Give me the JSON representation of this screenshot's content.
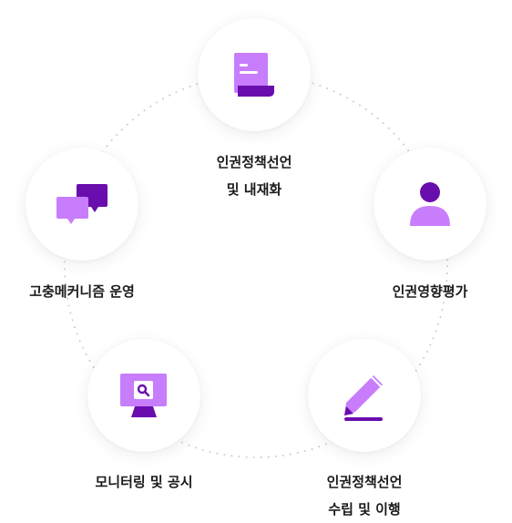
{
  "nodes": [
    {
      "id": "policy-declaration",
      "icon": "document-scroll-icon",
      "lines": [
        "인권정책선언",
        "및 내재화"
      ]
    },
    {
      "id": "impact-assessment",
      "icon": "person-icon",
      "lines": [
        "인권영향평가"
      ]
    },
    {
      "id": "declaration-implementation",
      "icon": "pencil-icon",
      "lines": [
        "인권정책선언",
        "수립 및 이행"
      ]
    },
    {
      "id": "monitoring",
      "icon": "monitor-search-icon",
      "lines": [
        "모니터링 및 공시"
      ]
    },
    {
      "id": "grievance",
      "icon": "chat-bubbles-icon",
      "lines": [
        "고충메커니즘 운영"
      ]
    }
  ],
  "colors": {
    "light_purple": "#c77dfc",
    "dark_purple": "#6a0dad",
    "ring_dots": "#cfcfcf"
  }
}
